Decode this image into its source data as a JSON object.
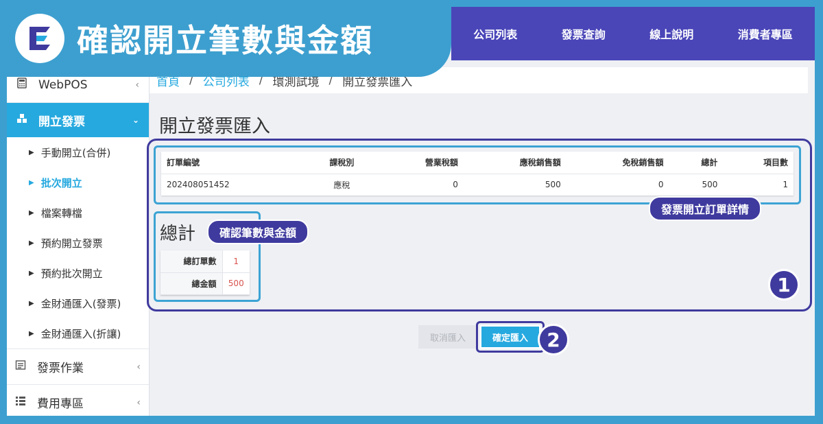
{
  "banner": {
    "title": "確認開立筆數與金額"
  },
  "topnav": {
    "items": [
      "公司列表",
      "發票查詢",
      "線上說明",
      "消費者專區"
    ]
  },
  "sidebar": {
    "top_item": "WebPOS",
    "active_item": "開立發票",
    "sub_items": [
      "手動開立(合併)",
      "批次開立",
      "檔案轉檔",
      "預約開立發票",
      "預約批次開立",
      "金財通匯入(發票)",
      "金財通匯入(折讓)"
    ],
    "bottom_items": [
      "發票作業",
      "費用專區"
    ]
  },
  "breadcrumb": [
    "首頁",
    "公司列表",
    "環測試境",
    "開立發票匯入"
  ],
  "page": {
    "title": "開立發票匯入"
  },
  "orders_table": {
    "headers": [
      "訂單編號",
      "課稅別",
      "營業稅額",
      "應稅銷售額",
      "免稅銷售額",
      "總計",
      "項目數"
    ],
    "rows": [
      [
        "202408051452",
        "應稅",
        "0",
        "500",
        "0",
        "500",
        "1"
      ]
    ]
  },
  "annotations": {
    "order_detail_tag": "發票開立訂單詳情",
    "confirm_tag": "確認筆數與金額",
    "step1": "1",
    "step2": "2"
  },
  "totals": {
    "title": "總計",
    "order_count_label": "總訂單數",
    "order_count": "1",
    "amount_label": "總金額",
    "amount": "500"
  },
  "buttons": {
    "cancel": "取消匯入",
    "confirm": "確定匯入"
  },
  "colors": {
    "accent": "#26a9df",
    "nav": "#4a46b8",
    "annotation": "#3f3a9e",
    "highlight": "#3ca3d4"
  }
}
